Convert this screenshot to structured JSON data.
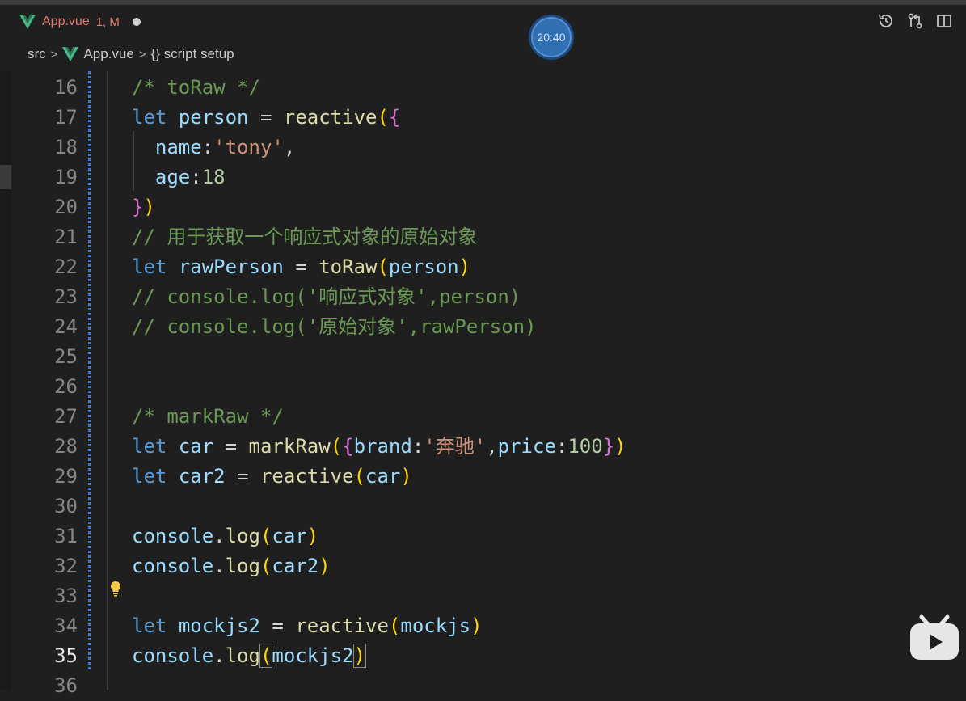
{
  "tab": {
    "file_name": "App.vue",
    "status": "1, M"
  },
  "clock": {
    "time": "20:40"
  },
  "breadcrumb": {
    "folder": "src",
    "file": "App.vue",
    "symbol": "{} script setup"
  },
  "editor": {
    "lines": [
      {
        "number": "16"
      },
      {
        "number": "17"
      },
      {
        "number": "18"
      },
      {
        "number": "19"
      },
      {
        "number": "20"
      },
      {
        "number": "21"
      },
      {
        "number": "22"
      },
      {
        "number": "23"
      },
      {
        "number": "24"
      },
      {
        "number": "25"
      },
      {
        "number": "26"
      },
      {
        "number": "27"
      },
      {
        "number": "28"
      },
      {
        "number": "29"
      },
      {
        "number": "30"
      },
      {
        "number": "31"
      },
      {
        "number": "32"
      },
      {
        "number": "33"
      },
      {
        "number": "34"
      },
      {
        "number": "35"
      },
      {
        "number": "36"
      }
    ],
    "code": {
      "l16": "/* toRaw */",
      "l17_kw": "let",
      "l17_var": "person",
      "l17_op": "=",
      "l17_fn": "reactive",
      "l18_key": "name",
      "l18_val": "'tony'",
      "l19_key": "age",
      "l19_val": "18",
      "l21": "// 用于获取一个响应式对象的原始对象",
      "l22_kw": "let",
      "l22_var": "rawPerson",
      "l22_op": "=",
      "l22_fn": "toRaw",
      "l22_arg": "person",
      "l23": "// console.log('响应式对象',person)",
      "l24": "// console.log('原始对象',rawPerson)",
      "l27": "/* markRaw */",
      "l28_kw": "let",
      "l28_var": "car",
      "l28_op": "=",
      "l28_fn": "markRaw",
      "l28_k1": "brand",
      "l28_v1": "'奔驰'",
      "l28_k2": "price",
      "l28_v2": "100",
      "l29_kw": "let",
      "l29_var": "car2",
      "l29_op": "=",
      "l29_fn": "reactive",
      "l29_arg": "car",
      "l31_obj": "console",
      "l31_fn": "log",
      "l31_arg": "car",
      "l32_obj": "console",
      "l32_fn": "log",
      "l32_arg": "car2",
      "l34_kw": "let",
      "l34_var": "mockjs2",
      "l34_op": "=",
      "l34_fn": "reactive",
      "l34_arg": "mockjs",
      "l35_obj": "console",
      "l35_fn": "log",
      "l35_arg": "mockjs2"
    }
  },
  "colors": {
    "keyword": "#569cd6",
    "variable": "#9cdcfe",
    "function": "#dcdcaa",
    "string": "#ce9178",
    "number": "#b5cea8",
    "comment": "#6a9955",
    "tab_modified": "#e27a6c"
  }
}
